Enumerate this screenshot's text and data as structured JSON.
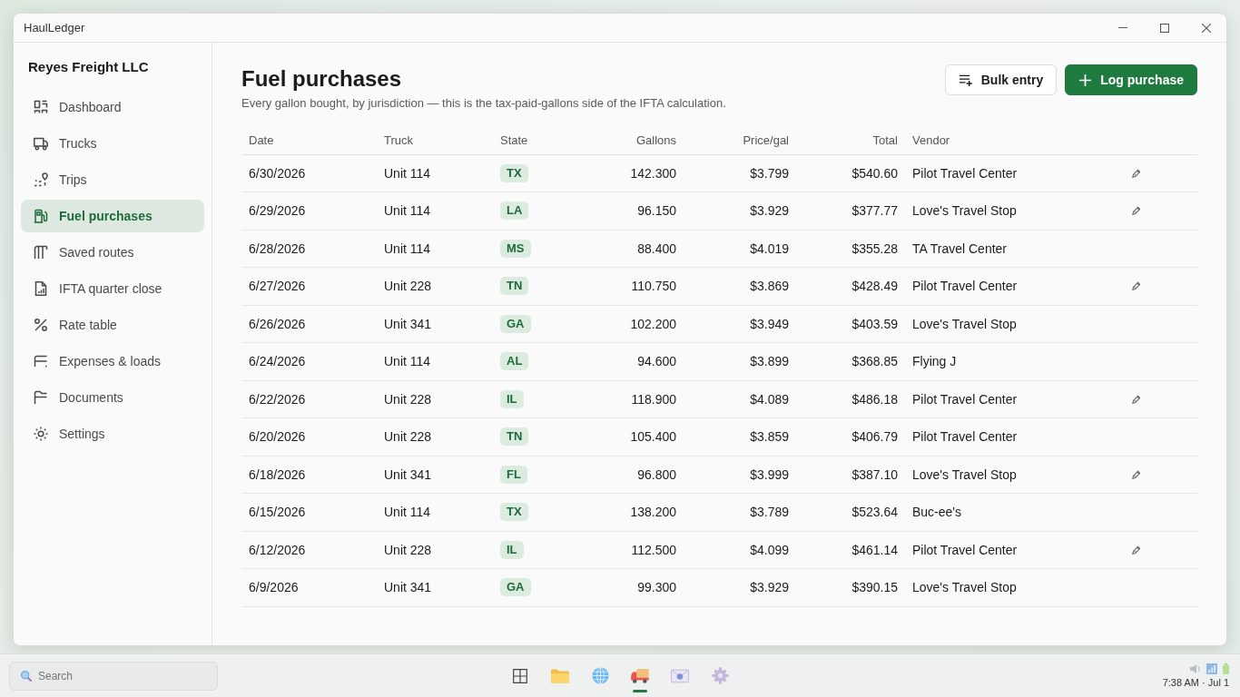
{
  "window": {
    "title": "HaulLedger"
  },
  "sidebar": {
    "company": "Reyes Freight LLC",
    "items": [
      {
        "label": "Dashboard",
        "selected": false
      },
      {
        "label": "Trucks",
        "selected": false
      },
      {
        "label": "Trips",
        "selected": false
      },
      {
        "label": "Fuel purchases",
        "selected": true
      },
      {
        "label": "Saved routes",
        "selected": false
      },
      {
        "label": "IFTA quarter close",
        "selected": false
      },
      {
        "label": "Rate table",
        "selected": false
      },
      {
        "label": "Expenses & loads",
        "selected": false
      },
      {
        "label": "Documents",
        "selected": false
      },
      {
        "label": "Settings",
        "selected": false
      }
    ]
  },
  "page": {
    "title": "Fuel purchases",
    "subtitle": "Every gallon bought, by jurisdiction — this is the tax-paid-gallons side of the IFTA calculation.",
    "buttons": [
      {
        "label": "Bulk entry",
        "kind": "secondary"
      },
      {
        "label": "Log purchase",
        "kind": "primary"
      }
    ]
  },
  "table": {
    "columns": [
      "Date",
      "Truck",
      "State",
      "Gallons",
      "Price/gal",
      "Total",
      "Vendor"
    ],
    "rows": [
      {
        "date": "6/30/2026",
        "truck": "Unit 114",
        "state": "TX",
        "gallons": "142.300",
        "price_per_gal": "$3.799",
        "total": "$540.60",
        "vendor": "Pilot Travel Center",
        "editable": true
      },
      {
        "date": "6/29/2026",
        "truck": "Unit 114",
        "state": "LA",
        "gallons": "96.150",
        "price_per_gal": "$3.929",
        "total": "$377.77",
        "vendor": "Love's Travel Stop",
        "editable": true
      },
      {
        "date": "6/28/2026",
        "truck": "Unit 114",
        "state": "MS",
        "gallons": "88.400",
        "price_per_gal": "$4.019",
        "total": "$355.28",
        "vendor": "TA Travel Center",
        "editable": false
      },
      {
        "date": "6/27/2026",
        "truck": "Unit 228",
        "state": "TN",
        "gallons": "110.750",
        "price_per_gal": "$3.869",
        "total": "$428.49",
        "vendor": "Pilot Travel Center",
        "editable": true
      },
      {
        "date": "6/26/2026",
        "truck": "Unit 341",
        "state": "GA",
        "gallons": "102.200",
        "price_per_gal": "$3.949",
        "total": "$403.59",
        "vendor": "Love's Travel Stop",
        "editable": false
      },
      {
        "date": "6/24/2026",
        "truck": "Unit 114",
        "state": "AL",
        "gallons": "94.600",
        "price_per_gal": "$3.899",
        "total": "$368.85",
        "vendor": "Flying J",
        "editable": false
      },
      {
        "date": "6/22/2026",
        "truck": "Unit 228",
        "state": "IL",
        "gallons": "118.900",
        "price_per_gal": "$4.089",
        "total": "$486.18",
        "vendor": "Pilot Travel Center",
        "editable": true
      },
      {
        "date": "6/20/2026",
        "truck": "Unit 228",
        "state": "TN",
        "gallons": "105.400",
        "price_per_gal": "$3.859",
        "total": "$406.79",
        "vendor": "Pilot Travel Center",
        "editable": false
      },
      {
        "date": "6/18/2026",
        "truck": "Unit 341",
        "state": "FL",
        "gallons": "96.800",
        "price_per_gal": "$3.999",
        "total": "$387.10",
        "vendor": "Love's Travel Stop",
        "editable": true
      },
      {
        "date": "6/15/2026",
        "truck": "Unit 114",
        "state": "TX",
        "gallons": "138.200",
        "price_per_gal": "$3.789",
        "total": "$523.64",
        "vendor": "Buc-ee's",
        "editable": false
      },
      {
        "date": "6/12/2026",
        "truck": "Unit 228",
        "state": "IL",
        "gallons": "112.500",
        "price_per_gal": "$4.099",
        "total": "$461.14",
        "vendor": "Pilot Travel Center",
        "editable": true
      },
      {
        "date": "6/9/2026",
        "truck": "Unit 341",
        "state": "GA",
        "gallons": "99.300",
        "price_per_gal": "$3.929",
        "total": "$390.15",
        "vendor": "Love's Travel Stop",
        "editable": false
      }
    ]
  },
  "taskbar": {
    "search": {
      "placeholder": "Search"
    },
    "apps": [
      {
        "selected": false
      },
      {
        "selected": false
      },
      {
        "selected": false
      },
      {
        "selected": true
      },
      {
        "selected": false
      },
      {
        "selected": false
      }
    ],
    "clock": "7:38 AM · Jul 1"
  }
}
